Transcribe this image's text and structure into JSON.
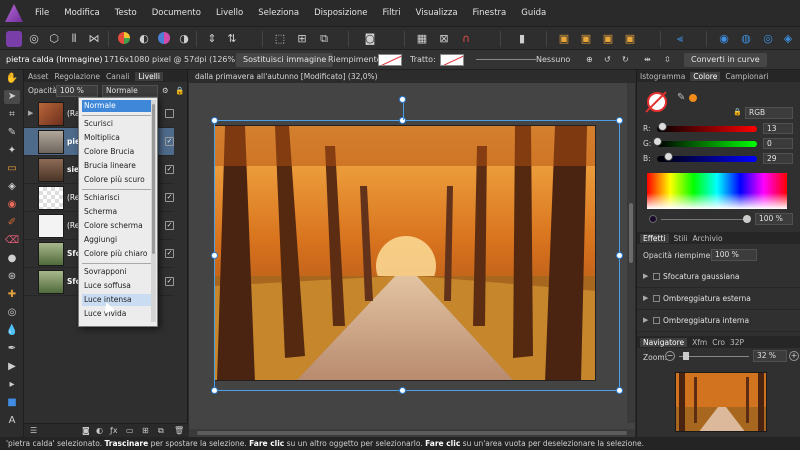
{
  "menu": [
    "File",
    "Modifica",
    "Testo",
    "Documento",
    "Livello",
    "Seleziona",
    "Disposizione",
    "Filtri",
    "Visualizza",
    "Finestra",
    "Guida"
  ],
  "context": {
    "layer_name": "pietra calda (Immagine)",
    "layer_info": "1716x1080 pixel @ 57dpi (126%)",
    "replace_button": "Sostituisci immagine",
    "fill_label": "Riempimento:",
    "stroke_label": "Tratto:",
    "none_label": "Nessuno",
    "convert_button": "Converti in curve"
  },
  "layers_panel": {
    "tabs": [
      "Asset",
      "Regolazione",
      "Canali",
      "Livelli"
    ],
    "active_tab": "Livelli",
    "opacity_label": "Opacità:",
    "opacity_value": "100 %",
    "blend_value": "Normale",
    "layers": [
      {
        "name": "(Ragg",
        "selected": false
      },
      {
        "name": "pie",
        "selected": true
      },
      {
        "name": "sie",
        "selected": false
      },
      {
        "name": "(Re",
        "selected": false
      },
      {
        "name": "(Re",
        "selected": false
      },
      {
        "name": "Sfo",
        "selected": false
      },
      {
        "name": "Sfo",
        "selected": false
      }
    ]
  },
  "blend_modes": {
    "groups": [
      [
        "Normale"
      ],
      [
        "Scurisci",
        "Moltiplica",
        "Colore Brucia",
        "Brucia lineare",
        "Colore più scuro"
      ],
      [
        "Schiarisci",
        "Scherma",
        "Colore scherma",
        "Aggiungi",
        "Colore più chiaro"
      ],
      [
        "Sovrapponi",
        "Luce soffusa",
        "Luce intensa",
        "Luce vivida"
      ]
    ],
    "selected": "Normale",
    "hovered": "Luce intensa"
  },
  "document": {
    "title": "dalla primavera all'autunno [Modificato] (32,0%)"
  },
  "color_panel": {
    "tabs": [
      "Istogramma",
      "Colore",
      "Campionari"
    ],
    "active_tab": "Colore",
    "model": "RGB",
    "channels": [
      {
        "label": "R:",
        "value": "13",
        "fraction": 0.05,
        "track": "linear-gradient(to right,#000,#f00)"
      },
      {
        "label": "G:",
        "value": "0",
        "fraction": 0.0,
        "track": "linear-gradient(to right,#000,#0f0)"
      },
      {
        "label": "B:",
        "value": "29",
        "fraction": 0.11,
        "track": "linear-gradient(to right,#000,#00f)"
      }
    ],
    "opacity_value": "100 %"
  },
  "effects_panel": {
    "tabs": [
      "Effetti",
      "Stili",
      "Archivio"
    ],
    "active_tab": "Effetti",
    "fill_opacity_label": "Opacità riempimento:",
    "fill_opacity_value": "100 %",
    "effects": [
      "Sfocatura gaussiana",
      "Ombreggiatura esterna",
      "Ombreggiatura interna"
    ]
  },
  "navigator": {
    "tabs": [
      "Navigatore",
      "Xfm",
      "Cro",
      "32P"
    ],
    "active_tab": "Navigatore",
    "zoom_label": "Zoom:",
    "zoom_value": "32 %"
  },
  "status": {
    "s1": "'pietra calda' selezionato. ",
    "b1": "Trascinare",
    "s2": " per spostare la selezione. ",
    "b2": "Fare clic",
    "s3": " su un altro oggetto per selezionarlo. ",
    "b3": "Fare clic",
    "s4": " su un'area vuota per deselezionare la selezione."
  },
  "colors": {
    "accent": "#3f88d9",
    "selection": "#4a9fe6",
    "selected_layer": "#4f6b8c"
  }
}
